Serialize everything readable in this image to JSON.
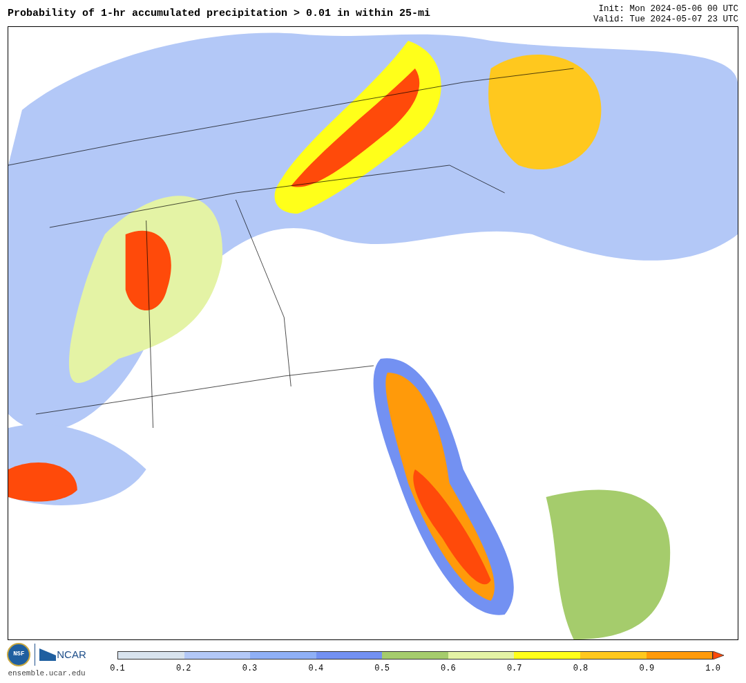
{
  "title": "Probability of 1-hr accumulated precipitation > 0.01 in within 25-mi",
  "init": "Init: Mon 2024-05-06 00 UTC",
  "valid": "Valid: Tue 2024-05-07 23 UTC",
  "logo": {
    "nsf": "NSF",
    "ncar": "NCAR",
    "url": "ensemble.ucar.edu"
  },
  "colorbar": {
    "segments": [
      {
        "kind": "band",
        "color": "#d8e3ee"
      },
      {
        "kind": "band",
        "color": "#b3c8f7"
      },
      {
        "kind": "band",
        "color": "#8fb0f6"
      },
      {
        "kind": "band",
        "color": "#7391f2"
      },
      {
        "kind": "band",
        "color": "#a5cc6c"
      },
      {
        "kind": "band",
        "color": "#e4f3a5"
      },
      {
        "kind": "band",
        "color": "#ffff1a"
      },
      {
        "kind": "band",
        "color": "#ffc81e"
      },
      {
        "kind": "band",
        "color": "#ff9a0a"
      },
      {
        "kind": "extend",
        "color": "#ff4a0a"
      }
    ],
    "ticks": [
      "0.1",
      "0.2",
      "0.3",
      "0.4",
      "0.5",
      "0.6",
      "0.7",
      "0.8",
      "0.9",
      "1.0"
    ]
  }
}
